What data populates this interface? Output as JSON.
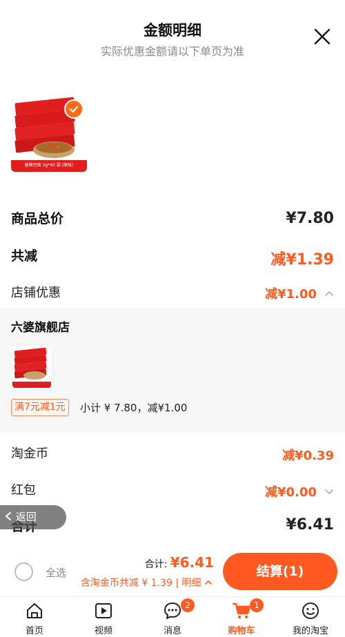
{
  "header": {
    "title": "金额明细",
    "subtitle": "实际优惠金额请以下单页为准"
  },
  "product": {
    "caption": "香辣豆豉 2g*40 袋 (原味)"
  },
  "summary": {
    "total_label": "商品总价",
    "total_value": "¥7.80",
    "discount_label": "共减",
    "discount_value": "减¥1.39",
    "store_discount_label": "店铺优惠",
    "store_discount_value": "减¥1.00"
  },
  "store": {
    "name": "六婆旗舰店",
    "promo_tag": "满7元减1元",
    "subtotal": "小计 ¥ 7.80，减¥1.00"
  },
  "coins": {
    "label": "淘金币",
    "value": "减¥0.39"
  },
  "redpacket": {
    "label": "红包",
    "value": "减¥0.00"
  },
  "grand_total": {
    "label": "合计",
    "value": "¥6.41"
  },
  "back": {
    "label": "返回"
  },
  "bottom_bar": {
    "select_all": "全选",
    "total_prefix": "合计:",
    "total_amount": "¥6.41",
    "detail_text": "含淘金币共减 ¥ 1.39 | 明细",
    "checkout_label": "结算(1)"
  },
  "tabs": [
    {
      "label": "首页",
      "icon": "home-icon",
      "badge": ""
    },
    {
      "label": "视频",
      "icon": "video-icon",
      "badge": ""
    },
    {
      "label": "消息",
      "icon": "message-icon",
      "badge": "2"
    },
    {
      "label": "购物车",
      "icon": "cart-icon",
      "badge": "1",
      "active": true
    },
    {
      "label": "我的淘宝",
      "icon": "profile-icon",
      "badge": ""
    }
  ],
  "colors": {
    "accent": "#ff5a1f",
    "muted": "#8a8a8a",
    "panel": "#f6f6f6"
  }
}
